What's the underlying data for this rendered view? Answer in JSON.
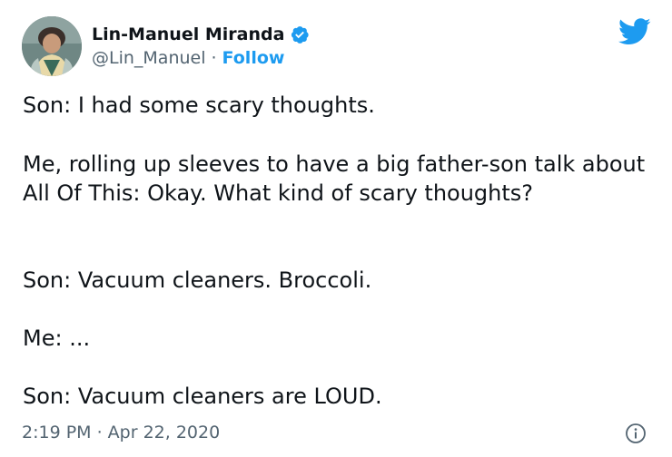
{
  "author": {
    "display_name": "Lin-Manuel Miranda",
    "handle": "@Lin_Manuel",
    "separator": "·",
    "follow_label": "Follow"
  },
  "tweet": {
    "paragraphs": [
      "Son: I had some scary thoughts.",
      "Me, rolling up sleeves to have a big father-son talk about All Of This: Okay. What kind of scary thoughts?",
      "Son: Vacuum cleaners. Broccoli.",
      "Me: ...",
      "Son: Vacuum cleaners are LOUD."
    ],
    "timestamp": "2:19 PM · Apr 22, 2020"
  },
  "icons": {
    "verified": "verified-badge-icon",
    "brand": "twitter-bird-icon",
    "info": "info-icon"
  },
  "colors": {
    "accent": "#1d9bf0",
    "text": "#0f1419",
    "muted": "#536471"
  }
}
